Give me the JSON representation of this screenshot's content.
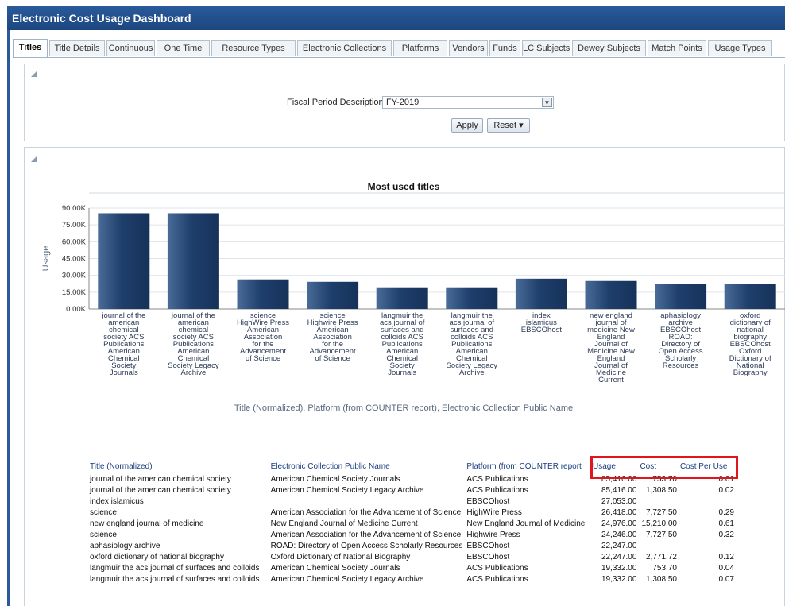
{
  "app": {
    "title": "Electronic Cost Usage Dashboard"
  },
  "tabs": [
    "Titles",
    "Title Details",
    "Continuous",
    "One Time",
    "Resource Types",
    "Electronic Collections",
    "Platforms",
    "Vendors",
    "Funds",
    "LC Subjects",
    "Dewey Subjects",
    "Match Points",
    "Usage Types"
  ],
  "filter": {
    "label": "Fiscal Period Description",
    "value": "FY-2019",
    "apply_label": "Apply",
    "reset_label": "Reset ▾"
  },
  "chart_data": {
    "type": "bar",
    "title": "Most used titles",
    "ylabel": "Usage",
    "xlabel": "Title (Normalized), Platform (from COUNTER report), Electronic Collection Public Name",
    "ylim": [
      0,
      90000
    ],
    "yticks": [
      "90.00K",
      "75.00K",
      "60.00K",
      "45.00K",
      "30.00K",
      "15.00K",
      "0.00K"
    ],
    "categories": [
      [
        "journal of the",
        "american",
        "chemical",
        "society ACS",
        "Publications",
        "American",
        "Chemical",
        "Society",
        "Journals"
      ],
      [
        "journal of the",
        "american",
        "chemical",
        "society ACS",
        "Publications",
        "American",
        "Chemical",
        "Society Legacy",
        "Archive"
      ],
      [
        "science",
        "HighWire Press",
        "American",
        "Association",
        "for the",
        "Advancement",
        "of Science"
      ],
      [
        "science",
        "Highwire Press",
        "American",
        "Association",
        "for the",
        "Advancement",
        "of Science"
      ],
      [
        "langmuir the",
        "acs journal of",
        "surfaces and",
        "colloids ACS",
        "Publications",
        "American",
        "Chemical",
        "Society",
        "Journals"
      ],
      [
        "langmuir the",
        "acs journal of",
        "surfaces and",
        "colloids ACS",
        "Publications",
        "American",
        "Chemical",
        "Society Legacy",
        "Archive"
      ],
      [
        "index",
        "islamicus",
        "EBSCOhost"
      ],
      [
        "new england",
        "journal of",
        "medicine New",
        "England",
        "Journal of",
        "Medicine New",
        "England",
        "Journal of",
        "Medicine",
        "Current"
      ],
      [
        "aphasiology",
        "archive",
        "EBSCOhost",
        "ROAD:",
        "Directory of",
        "Open Access",
        "Scholarly",
        "Resources"
      ],
      [
        "oxford",
        "dictionary of",
        "national",
        "biography",
        "EBSCOhost",
        "Oxford",
        "Dictionary of",
        "National",
        "Biography"
      ]
    ],
    "values": [
      85416,
      85416,
      26418,
      24246,
      19332,
      19332,
      27053,
      24976,
      22247,
      22247
    ],
    "bar_color": "#234a7a",
    "grid": true
  },
  "table": {
    "headers": [
      "Title (Normalized)",
      "Electronic Collection Public Name",
      "Platform (from COUNTER report",
      "Usage",
      "Cost",
      "Cost Per Use"
    ],
    "rows": [
      [
        "journal of the american chemical society",
        "American Chemical Society Journals",
        "ACS Publications",
        "85,416.00",
        "753.70",
        "0.01"
      ],
      [
        "journal of the american chemical society",
        "American Chemical Society Legacy Archive",
        "ACS Publications",
        "85,416.00",
        "1,308.50",
        "0.02"
      ],
      [
        "index islamicus",
        "",
        "EBSCOhost",
        "27,053.00",
        "",
        ""
      ],
      [
        "science",
        "American Association for the Advancement of Science",
        "HighWire Press",
        "26,418.00",
        "7,727.50",
        "0.29"
      ],
      [
        "new england journal of medicine",
        "New England Journal of Medicine Current",
        "New England Journal of Medicine",
        "24,976.00",
        "15,210.00",
        "0.61"
      ],
      [
        "science",
        "American Association for the Advancement of Science",
        "Highwire Press",
        "24,246.00",
        "7,727.50",
        "0.32"
      ],
      [
        "aphasiology archive",
        "ROAD: Directory of Open Access Scholarly Resources",
        "EBSCOhost",
        "22,247.00",
        "",
        ""
      ],
      [
        "oxford dictionary of national biography",
        "Oxford Dictionary of National Biography",
        "EBSCOhost",
        "22,247.00",
        "2,771.72",
        "0.12"
      ],
      [
        "langmuir the acs journal of surfaces and colloids",
        "American Chemical Society Journals",
        "ACS Publications",
        "19,332.00",
        "753.70",
        "0.04"
      ],
      [
        "langmuir the acs journal of surfaces and colloids",
        "American Chemical Society Legacy Archive",
        "ACS Publications",
        "19,332.00",
        "1,308.50",
        "0.07"
      ]
    ]
  }
}
